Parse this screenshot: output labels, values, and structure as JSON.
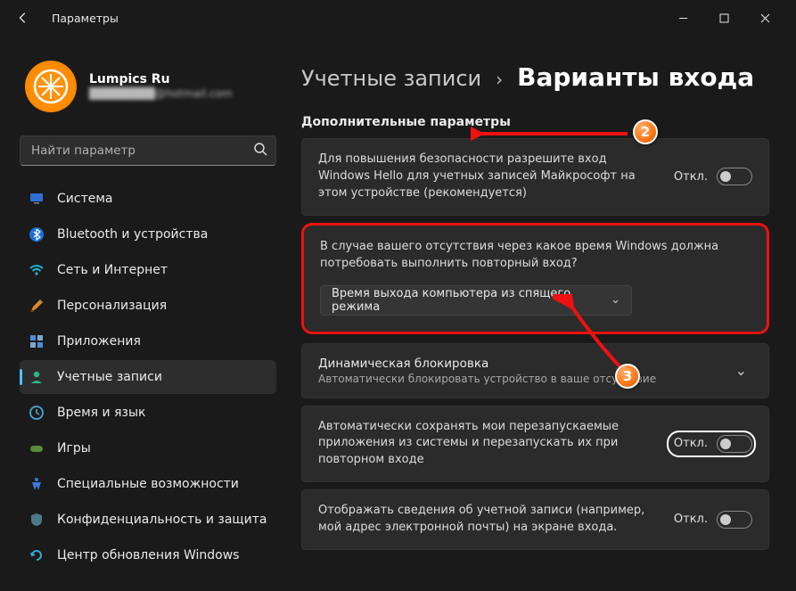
{
  "titlebar": {
    "title": "Параметры"
  },
  "profile": {
    "name": "Lumpics Ru",
    "email": "████████@hotmail.com"
  },
  "search": {
    "placeholder": "Найти параметр"
  },
  "sidebar": {
    "items": [
      {
        "label": "Система"
      },
      {
        "label": "Bluetooth и устройства"
      },
      {
        "label": "Сеть и Интернет"
      },
      {
        "label": "Персонализация"
      },
      {
        "label": "Приложения"
      },
      {
        "label": "Учетные записи"
      },
      {
        "label": "Время и язык"
      },
      {
        "label": "Игры"
      },
      {
        "label": "Специальные возможности"
      },
      {
        "label": "Конфиденциальность и защита"
      },
      {
        "label": "Центр обновления Windows"
      }
    ]
  },
  "breadcrumb": {
    "parent": "Учетные записи",
    "current": "Варианты входа"
  },
  "section": {
    "additional": "Дополнительные параметры"
  },
  "cards": {
    "hello": {
      "desc": "Для повышения безопасности разрешите вход Windows Hello для учетных записей Майкрософт на этом устройстве (рекомендуется)",
      "toggle": "Откл."
    },
    "relogin": {
      "desc": "В случае вашего отсутствия через какое время Windows должна потребовать выполнить повторный вход?",
      "dropdown": "Время выхода компьютера из спящего режима"
    },
    "dynlock": {
      "title": "Динамическая блокировка",
      "sub": "Автоматически блокировать устройство в ваше отсутствие"
    },
    "restart": {
      "desc": "Автоматически сохранять мои перезапускаемые приложения из системы и перезапускать их при повторном входе",
      "toggle": "Откл."
    },
    "accinfo": {
      "desc": "Отображать сведения об учетной записи (например, мой адрес электронной почты) на экране входа.",
      "toggle": "Откл."
    }
  }
}
